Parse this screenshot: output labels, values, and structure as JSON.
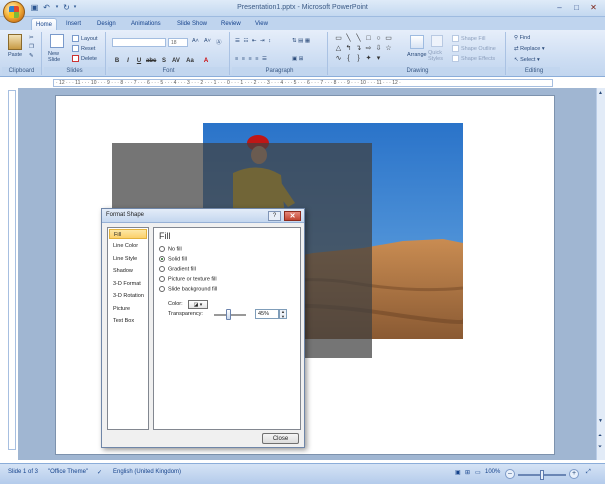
{
  "app": {
    "title": "Presentation1.pptx - Microsoft PowerPoint"
  },
  "tabs": [
    {
      "label": "Home"
    },
    {
      "label": "Insert"
    },
    {
      "label": "Design"
    },
    {
      "label": "Animations"
    },
    {
      "label": "Slide Show"
    },
    {
      "label": "Review"
    },
    {
      "label": "View"
    }
  ],
  "ribbon": {
    "clipboard": {
      "label": "Clipboard",
      "paste": "Paste"
    },
    "slides": {
      "label": "Slides",
      "new_slide": "New Slide",
      "layout": "Layout",
      "reset": "Reset",
      "delete": "Delete"
    },
    "font": {
      "label": "Font",
      "name": "",
      "size": "18"
    },
    "paragraph": {
      "label": "Paragraph"
    },
    "drawing": {
      "label": "Drawing",
      "arrange": "Arrange",
      "quick_styles": "Quick Styles",
      "shape_fill": "Shape Fill",
      "shape_outline": "Shape Outline",
      "shape_effects": "Shape Effects"
    },
    "editing": {
      "label": "Editing",
      "find": "Find",
      "replace": "Replace",
      "select": "Select"
    }
  },
  "ruler": {
    "text": "· 12 · · · 11 · · · 10 · · · 9 · · · 8 · · · 7 · · · 6 · · · 5 · · · 4 · · · 3 · · · 2 · · · 1 · · · 0 · · · 1 · · · 2 · · · 3 · · · 4 · · · 5 · · · 6 · · · 7 · · · 8 · · · 9 · · · 10 · · · 11 · · · 12 ·"
  },
  "dialog": {
    "title": "Format Shape",
    "help": "?",
    "nav": [
      {
        "label": "Fill"
      },
      {
        "label": "Line Color"
      },
      {
        "label": "Line Style"
      },
      {
        "label": "Shadow"
      },
      {
        "label": "3-D Format"
      },
      {
        "label": "3-D Rotation"
      },
      {
        "label": "Picture"
      },
      {
        "label": "Text Box"
      }
    ],
    "heading": "Fill",
    "options": [
      {
        "label": "No fill"
      },
      {
        "label": "Solid fill"
      },
      {
        "label": "Gradient fill"
      },
      {
        "label": "Picture or texture fill"
      },
      {
        "label": "Slide background fill"
      }
    ],
    "selected_option": "Solid fill",
    "color_label": "Color:",
    "transparency_label": "Transparency:",
    "transparency_value": "45%",
    "close_button": "Close"
  },
  "status": {
    "slide": "Slide 1 of 3",
    "theme": "\"Office Theme\"",
    "language": "English (United Kingdom)",
    "zoom": "100%"
  },
  "colors": {
    "overlay": "#404040",
    "accent": "#15428b"
  }
}
